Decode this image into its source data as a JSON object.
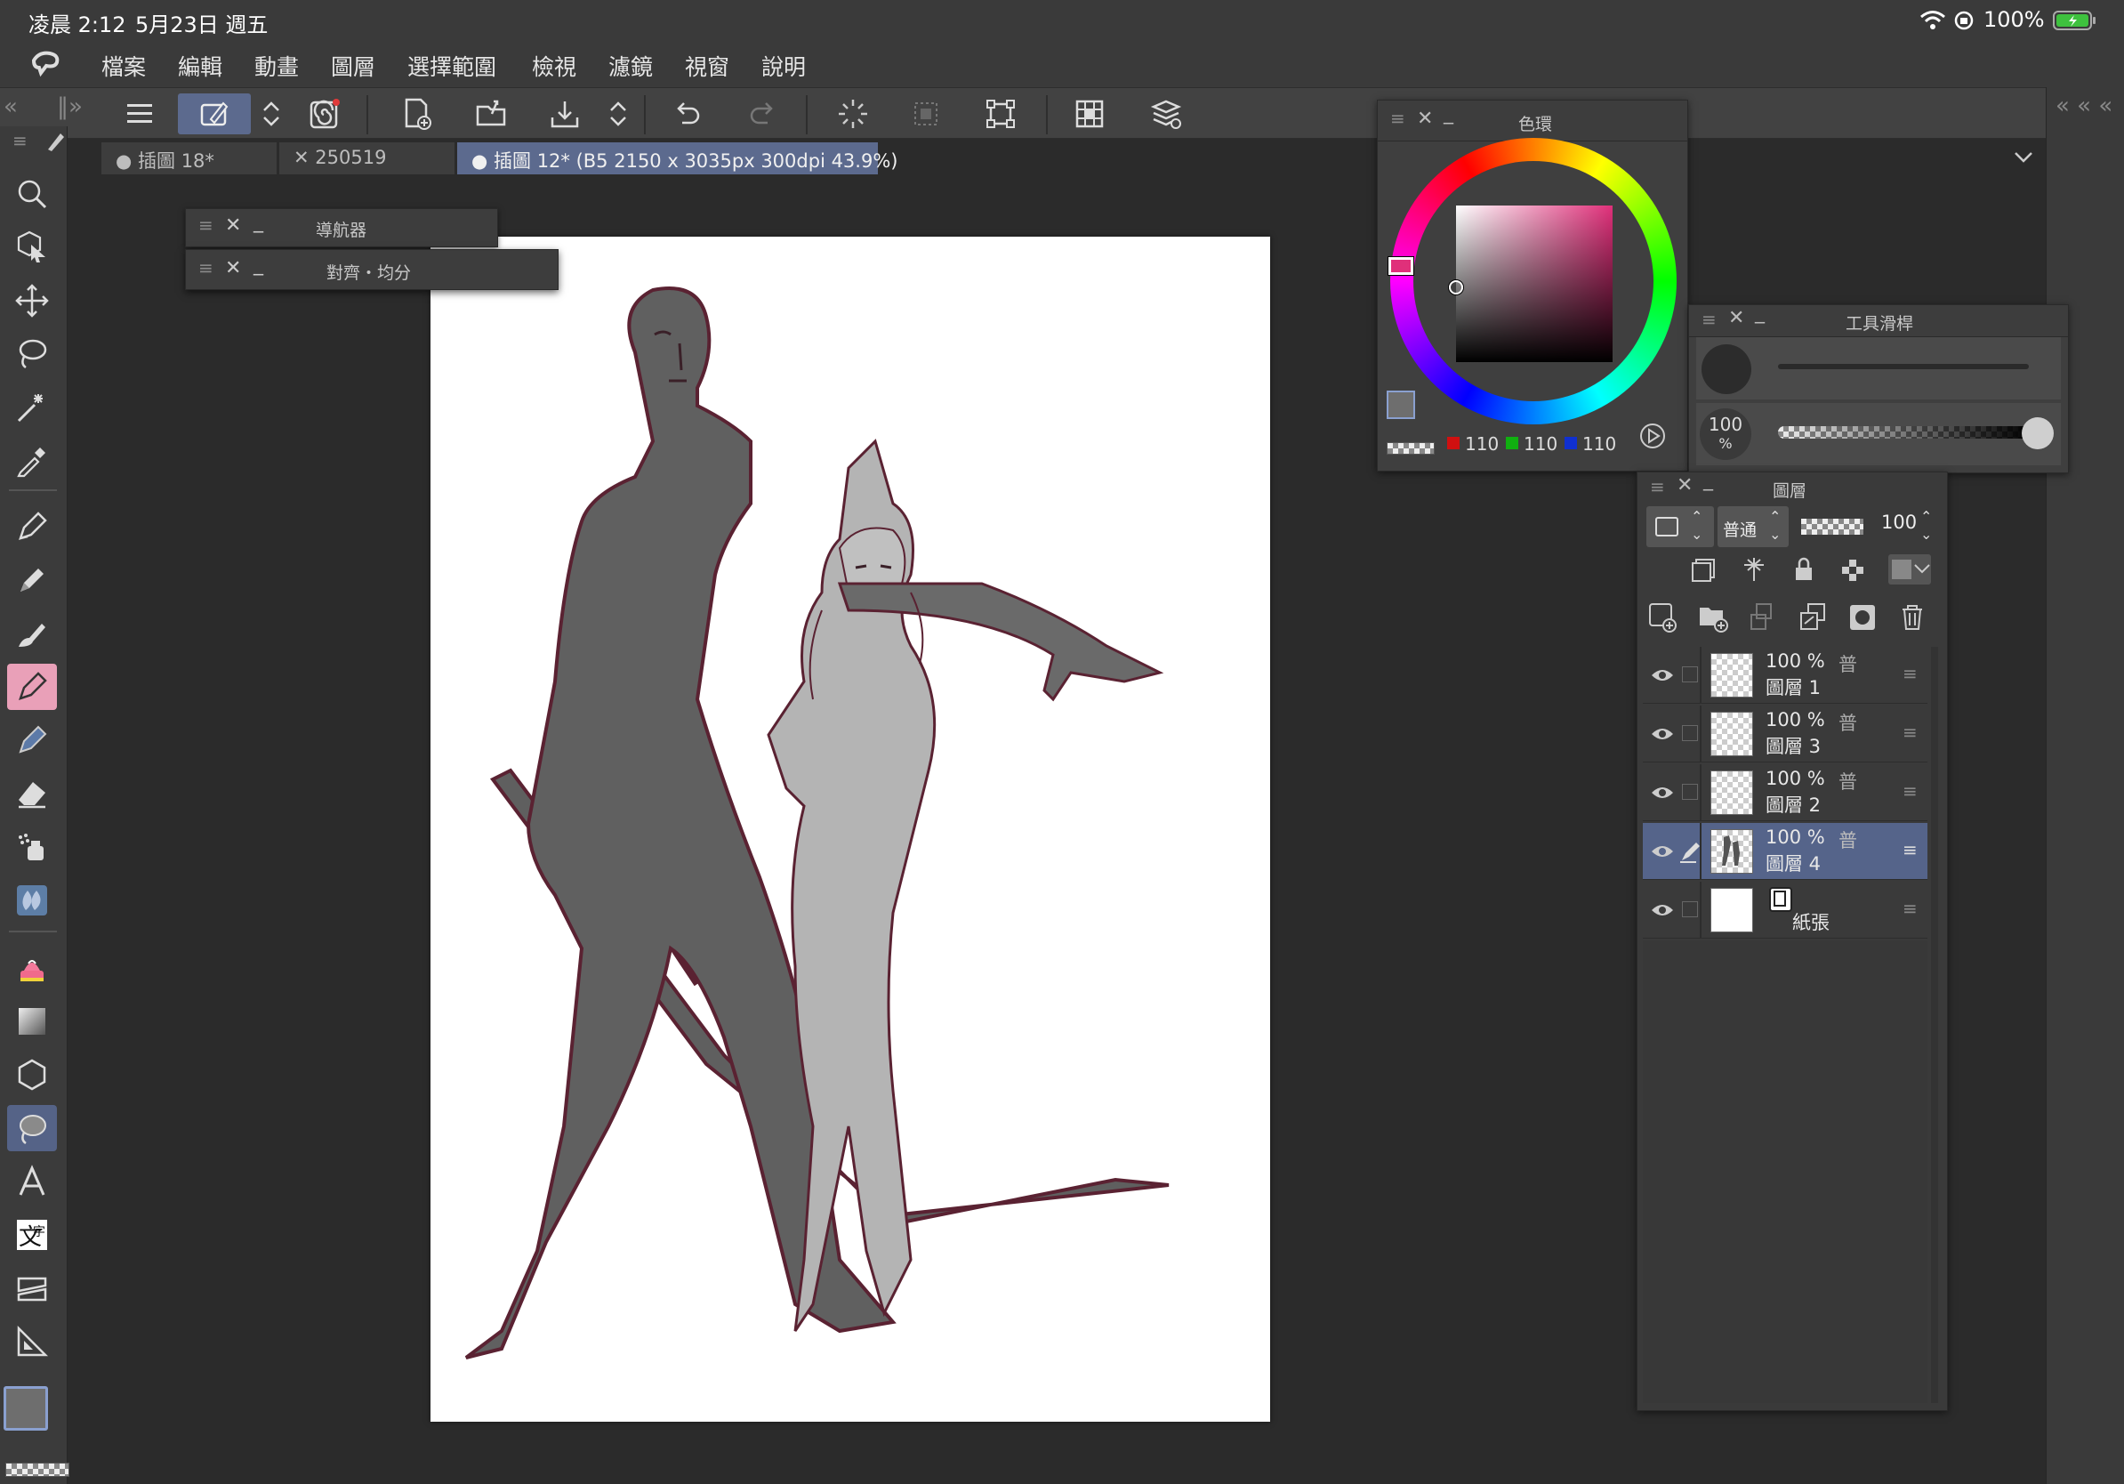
{
  "status_bar": {
    "time": "凌晨 2:12",
    "date": "5月23日 週五",
    "battery": "100%"
  },
  "menu": {
    "items": [
      "檔案",
      "編輯",
      "動畫",
      "圖層",
      "選擇範圍",
      "檢視",
      "濾鏡",
      "視窗",
      "說明"
    ]
  },
  "tabs": [
    {
      "label": "插圖 18*",
      "marker": "●"
    },
    {
      "label": "250519",
      "marker": "✕"
    },
    {
      "label": "插圖 12* (B5 2150 x 3035px 300dpi 43.9%)",
      "marker": "●"
    }
  ],
  "navigator_palette": {
    "title": "導航器",
    "sub_title": "對齊・均分"
  },
  "color_wheel": {
    "title": "色環",
    "r": "110",
    "g": "110",
    "b": "110"
  },
  "sub_tool_slider": {
    "title": "工具滑桿",
    "opacity_value": "100",
    "opacity_unit": "%"
  },
  "layer_palette": {
    "title": "圖層",
    "blend_mode": "普通",
    "opacity": "100",
    "layers": [
      {
        "opacity": "100 %",
        "mode": "普",
        "name": "圖層 1",
        "selected": false
      },
      {
        "opacity": "100 %",
        "mode": "普",
        "name": "圖層 3",
        "selected": false
      },
      {
        "opacity": "100 %",
        "mode": "普",
        "name": "圖層 2",
        "selected": false
      },
      {
        "opacity": "100 %",
        "mode": "普",
        "name": "圖層 4",
        "selected": true
      }
    ],
    "paper_layer": "紙張"
  },
  "colors": {
    "accent": "#556387",
    "sketch_line": "#6a2a38",
    "main_color": "#6e6e6e"
  },
  "icons": {
    "toolbar": [
      "menu-icon",
      "subtool-icon",
      "spiral-icon",
      "new-canvas-icon",
      "open-icon",
      "export-icon",
      "undo-icon",
      "redo-icon",
      "loading-icon",
      "select-icon",
      "transform-icon",
      "grid-icon",
      "layers-3d-icon"
    ]
  }
}
